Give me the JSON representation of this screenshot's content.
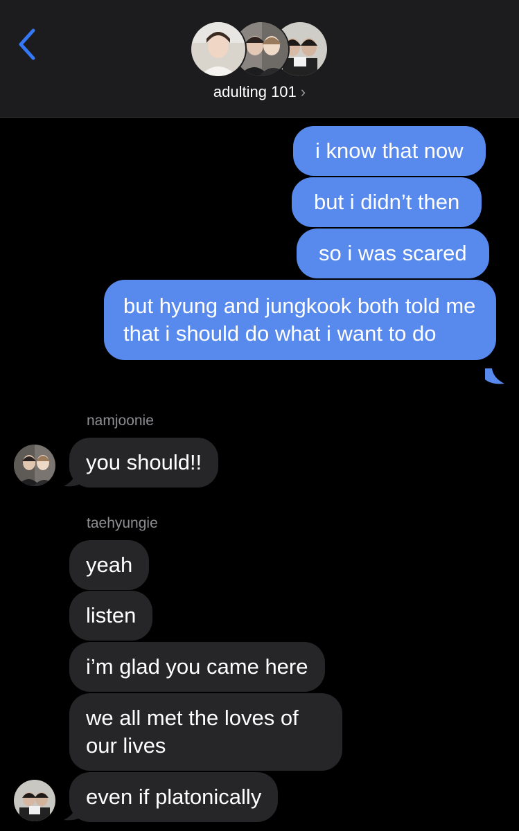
{
  "header": {
    "group_name": "adulting 101",
    "chevron": "›",
    "back_icon": "chevron-left-icon"
  },
  "colors": {
    "outgoing_bubble": "#5889ec",
    "incoming_bubble": "#262628",
    "header_bg": "#1c1c1e",
    "accent": "#3478f6"
  },
  "outgoing": [
    "i know that now",
    "but i didn’t then",
    "so i was scared",
    "but hyung and jungkook both told me that i should do what i want to do"
  ],
  "groups": [
    {
      "sender": "namjoonie",
      "messages": [
        "you should!!"
      ]
    },
    {
      "sender": "taehyungie",
      "messages": [
        "yeah",
        "listen",
        "i’m glad you came here",
        "we all met the loves of our lives",
        "even if platonically"
      ]
    }
  ]
}
